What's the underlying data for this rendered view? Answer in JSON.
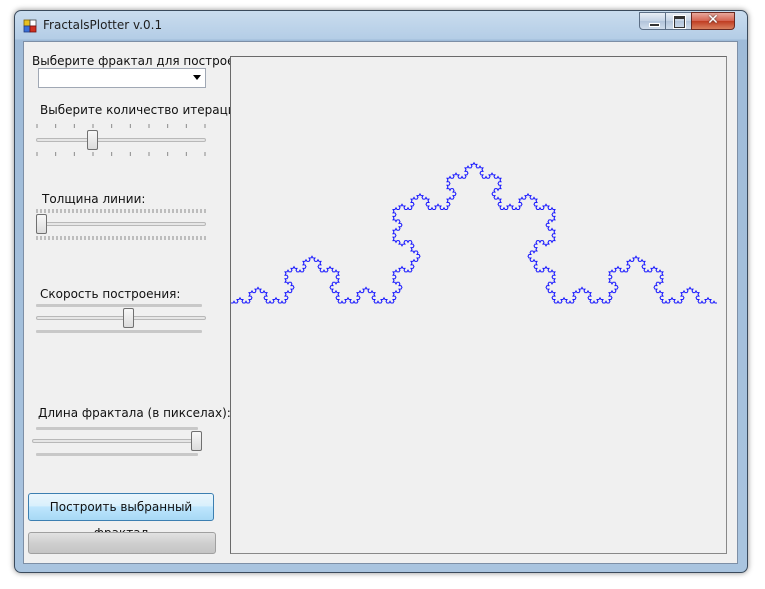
{
  "window": {
    "title": "FractalsPlotter v.0.1",
    "close_glyph": "✕"
  },
  "controls": {
    "fractal_label": "Выберите фрактал для построения",
    "fractal_value": "",
    "iterations_label": "Выберите количество итераций:",
    "iterations_level": 0.32,
    "thickness_label": "Толщина линии:",
    "thickness_level": 0.0,
    "speed_label": "Скорость построения:",
    "speed_level": 0.55,
    "length_label": "Длина фрактала (в пикселах):",
    "length_level": 1.0,
    "build_button": "Построить выбранный фрактал",
    "progress_value": 0
  },
  "canvas": {
    "fractal_type": "koch-curve",
    "fractal_iterations": 4,
    "fractal_color": "#1a1aff"
  },
  "colors": {
    "window_frame": "#a9c4df",
    "client_bg": "#f0f0f0",
    "button_accent": "#3c7fb1"
  }
}
